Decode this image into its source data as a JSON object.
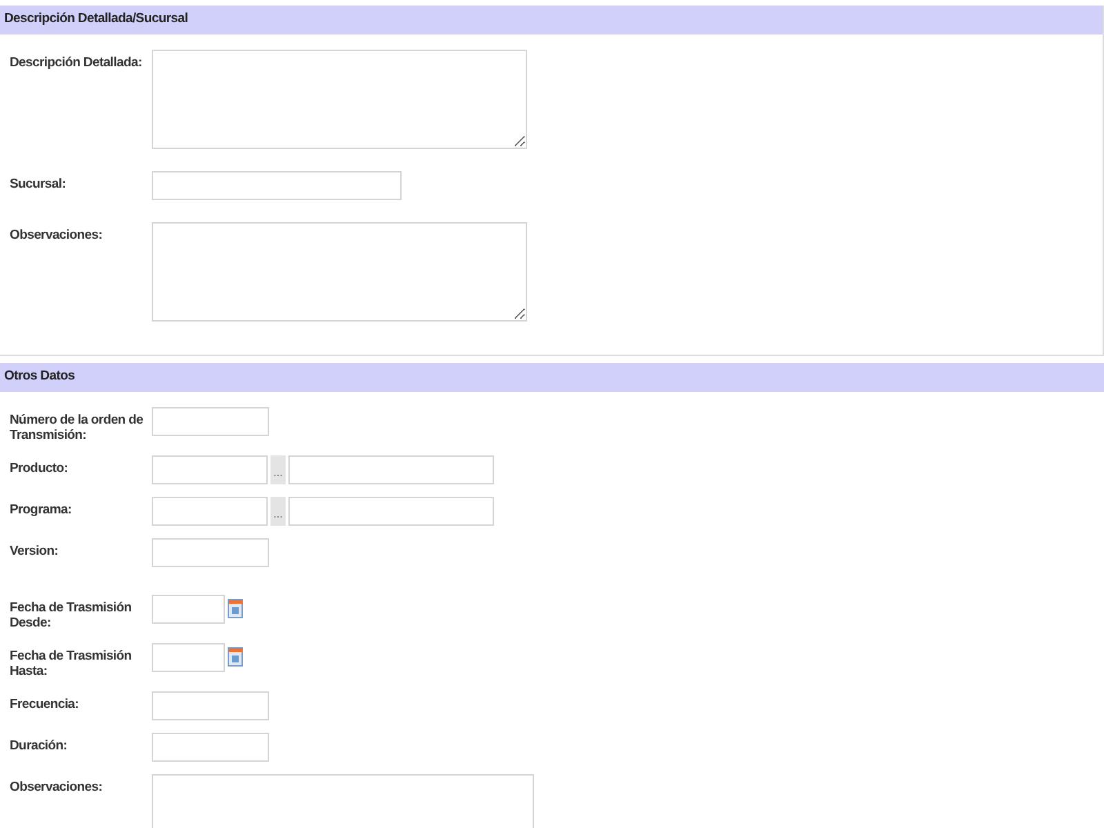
{
  "sections": [
    {
      "title": "Descripción Detallada/Sucursal",
      "fields": [
        {
          "label": "Descripción Detallada:",
          "kind": "textarea"
        },
        {
          "label": "Sucursal:",
          "kind": "text"
        },
        {
          "label": "Observaciones:",
          "kind": "textarea"
        }
      ]
    },
    {
      "title": "Otros Datos",
      "fields": [
        {
          "label": "Número de la orden de Transmisión:",
          "kind": "short"
        },
        {
          "label": "Producto:",
          "kind": "lookup",
          "button": "..."
        },
        {
          "label": "Programa:",
          "kind": "lookup",
          "button": "..."
        },
        {
          "label": "Version:",
          "kind": "short"
        },
        {
          "label": "Fecha de Trasmisión Desde:",
          "kind": "date"
        },
        {
          "label": "Fecha de Trasmisión Hasta:",
          "kind": "date"
        },
        {
          "label": "Frecuencia:",
          "kind": "short"
        },
        {
          "label": "Duración:",
          "kind": "short"
        },
        {
          "label": "Observaciones:",
          "kind": "wide"
        }
      ]
    }
  ]
}
